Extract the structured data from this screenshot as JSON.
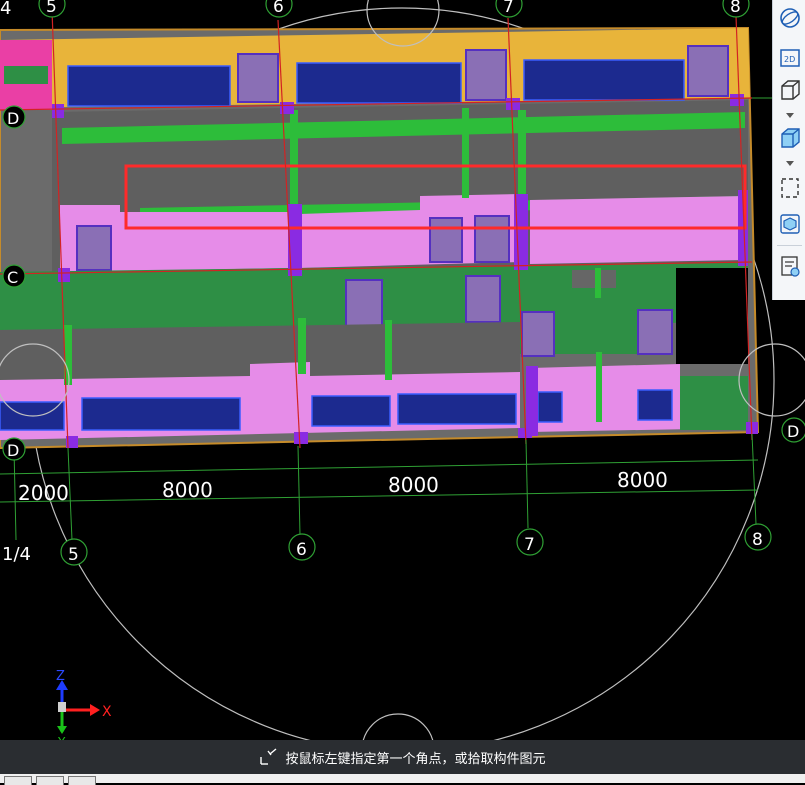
{
  "viewport": {
    "grid_labels_top": {
      "c4": "4",
      "c5": "5",
      "c6": "6",
      "c7": "7",
      "c8": "8"
    },
    "grid_labels_bottom": {
      "c14": "1/4",
      "c5": "5",
      "c6": "6",
      "c7": "7",
      "c8": "8"
    },
    "row_labels": {
      "d_top": "D",
      "c": "C",
      "d_bottom": "D",
      "d_right": "D"
    },
    "dimensions": {
      "d1": "2000",
      "d2": "8000",
      "d3": "8000",
      "d4": "8000"
    },
    "axis": {
      "z": "Z",
      "x": "X",
      "y": "Y"
    }
  },
  "toolbar": {
    "icons": [
      "orbit-icon",
      "view-2d-icon",
      "view-3d-icon",
      "cube-solid-icon",
      "window-select-icon",
      "component-display-icon",
      "display-settings-icon"
    ],
    "label_2d": "2D"
  },
  "statusbar": {
    "prompt": "按鼠标左键指定第一个角点，或拾取构件图元"
  },
  "colors": {
    "background": "#000000",
    "wall_yellow": "#e8b43a",
    "slab_pink": "#e68ce8",
    "floor_green": "#2e8f45",
    "beam_green": "#2dbd3a",
    "window_navy": "#1c2a8f",
    "column_purple": "#8a2be2",
    "selection_red": "#ff2a2a",
    "grid_red": "#d22323",
    "grid_green": "#2fa034"
  }
}
